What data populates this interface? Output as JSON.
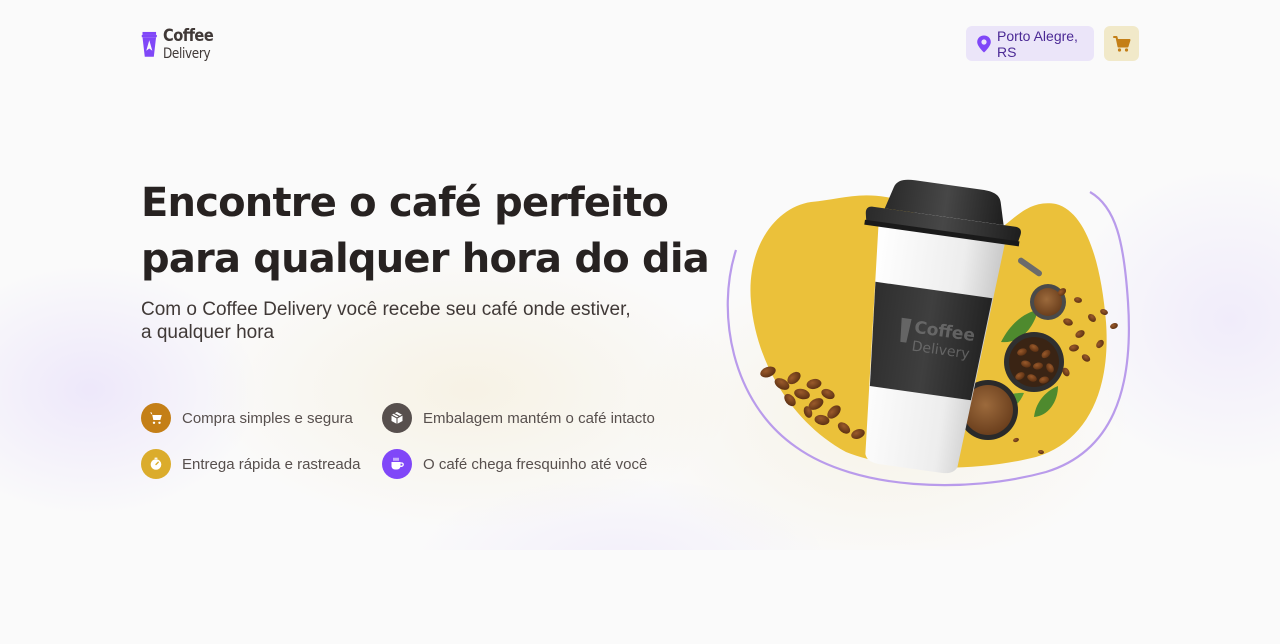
{
  "header": {
    "logo": {
      "line1": "Coffee",
      "line2": "Delivery",
      "icon": "coffee-cup-logo-icon"
    },
    "location": {
      "label": "Porto Alegre, RS",
      "icon": "map-pin-icon"
    },
    "cart": {
      "icon": "shopping-cart-icon"
    }
  },
  "hero": {
    "title_line1": "Encontre o café perfeito",
    "title_line2": "para qualquer hora do dia",
    "subtitle": "Com o Coffee Delivery você recebe seu café onde estiver, a qualquer hora",
    "features": [
      {
        "label": "Compra simples e segura",
        "icon": "shopping-cart-icon",
        "color": "#C47F17"
      },
      {
        "label": "Embalagem mantém o café intacto",
        "icon": "package-icon",
        "color": "#574F4D"
      },
      {
        "label": "Entrega rápida e rastreada",
        "icon": "timer-icon",
        "color": "#DBAC2C"
      },
      {
        "label": "O café chega fresquinho até você",
        "icon": "coffee-icon",
        "color": "#8047F8"
      }
    ],
    "image": {
      "cup_brand_line1": "Coffee",
      "cup_brand_line2": "Delivery",
      "description_icon": "coffee-cup-illustration"
    }
  },
  "colors": {
    "brand_purple": "#8047F8",
    "purple_light": "#EBE5F9",
    "purple_dark": "#4B2995",
    "yellow": "#DBAC2C",
    "yellow_dark": "#C47F17",
    "yellow_light": "#F1E9C9",
    "background": "#FAFAFA"
  }
}
